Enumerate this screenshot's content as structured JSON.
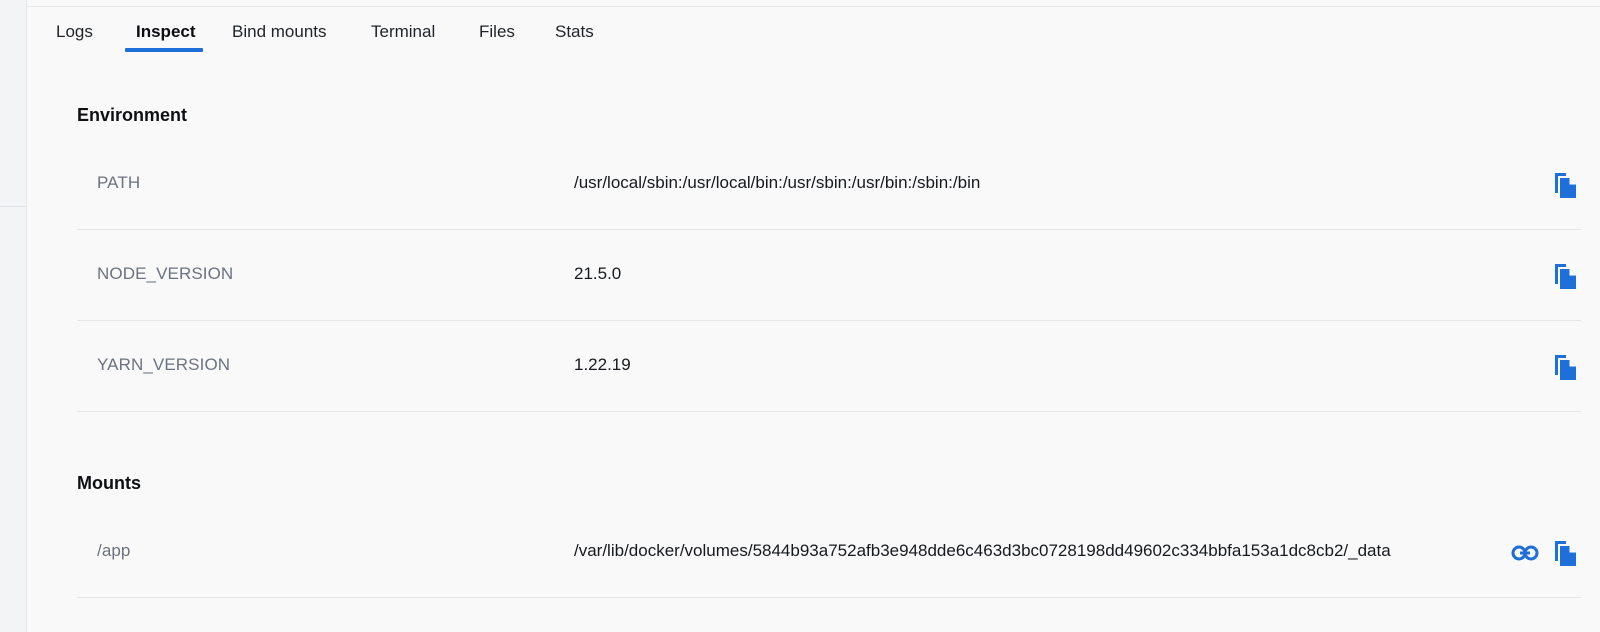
{
  "tabs": [
    {
      "label": "Logs"
    },
    {
      "label": "Inspect"
    },
    {
      "label": "Bind mounts"
    },
    {
      "label": "Terminal"
    },
    {
      "label": "Files"
    },
    {
      "label": "Stats"
    }
  ],
  "active_tab": "Inspect",
  "environment": {
    "title": "Environment",
    "rows": [
      {
        "key": "PATH",
        "value": "/usr/local/sbin:/usr/local/bin:/usr/sbin:/usr/bin:/sbin:/bin",
        "actions": [
          "copy-icon"
        ]
      },
      {
        "key": "NODE_VERSION",
        "value": "21.5.0",
        "actions": [
          "copy-icon"
        ]
      },
      {
        "key": "YARN_VERSION",
        "value": "1.22.19",
        "actions": [
          "copy-icon"
        ]
      }
    ]
  },
  "mounts": {
    "title": "Mounts",
    "rows": [
      {
        "key": "/app",
        "value": "/var/lib/docker/volumes/5844b93a752afb3e948dde6c463d3bc0728198dd49602c334bbfa153a1dc8cb2/_data",
        "actions": [
          "link-icon",
          "copy-icon"
        ]
      }
    ]
  },
  "colors": {
    "accent": "#1e6fd9",
    "key_text": "#6b7380",
    "value_text": "#16191d",
    "background": "#f9f9f9"
  }
}
